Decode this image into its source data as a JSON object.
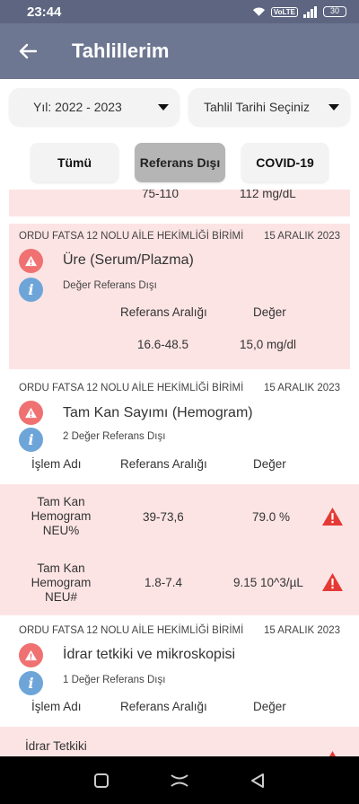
{
  "status": {
    "time": "23:44",
    "volte": "VoLTE",
    "battery": "30"
  },
  "appbar": {
    "title": "Tahlillerim"
  },
  "filters": {
    "year": "Yıl: 2022 - 2023",
    "date": "Tahlil Tarihi Seçiniz"
  },
  "tabs": [
    "Tümü",
    "Referans Dışı",
    "COVID-19"
  ],
  "partial_row": {
    "range": "75-110",
    "value": "112 mg/dL"
  },
  "results": [
    {
      "institution": "ORDU FATSA 12 NOLU AİLE HEKİMLİĞİ BİRİMİ",
      "date": "15 ARALIK 2023",
      "test": "Üre (Serum/Plazma)",
      "info": "Değer Referans Dışı",
      "ref_header": "Referans Aralığı",
      "value_header": "Değer",
      "range": "16.6-48.5",
      "value": "15,0 mg/dl"
    },
    {
      "institution": "ORDU FATSA 12 NOLU AİLE HEKİMLİĞİ BİRİMİ",
      "date": "15 ARALIK 2023",
      "test": "Tam Kan Sayımı (Hemogram)",
      "info": "2 Değer Referans Dışı",
      "headers": [
        "İşlem Adı",
        "Referans Aralığı",
        "Değer"
      ],
      "rows": [
        {
          "name": [
            "Tam Kan",
            "Hemogram",
            "NEU%"
          ],
          "range": "39-73,6",
          "value": "79.0 %"
        },
        {
          "name": [
            "Tam Kan",
            "Hemogram",
            "NEU#"
          ],
          "range": "1.8-7.4",
          "value": "9.15 10^3/µL"
        }
      ]
    },
    {
      "institution": "ORDU FATSA 12 NOLU AİLE HEKİMLİĞİ BİRİMİ",
      "date": "15 ARALIK 2023",
      "test": "İdrar tetkiki ve mikroskopisi",
      "info": "1 Değer Referans Dışı",
      "headers": [
        "İşlem Adı",
        "Referans Aralığı",
        "Değer"
      ],
      "rows": [
        {
          "name": [
            "İdrar Tetkiki"
          ]
        }
      ]
    }
  ],
  "colors": {
    "appbar": "#6e7791",
    "statusbar": "#5d6580",
    "out_of_range_bg": "#fde4e4",
    "warning": "#e53935",
    "info": "#6ea5d9"
  }
}
